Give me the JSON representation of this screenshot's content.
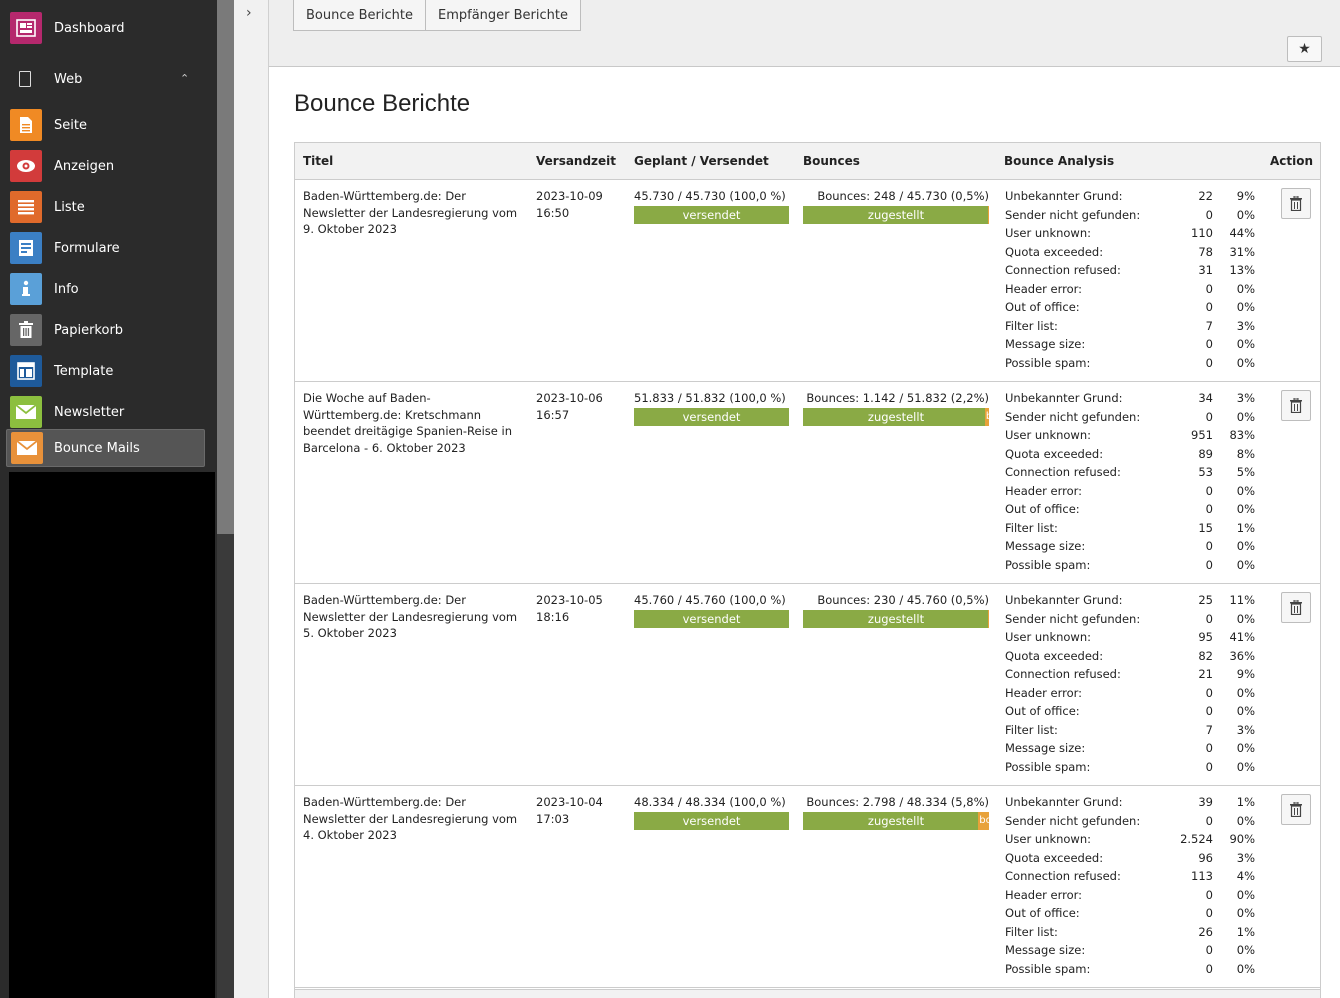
{
  "sidebar": {
    "dashboard": "Dashboard",
    "web_group": "Web",
    "items": [
      {
        "label": "Seite",
        "color": "#f08a24",
        "icon": "page-icon"
      },
      {
        "label": "Anzeigen",
        "color": "#d23b3b",
        "icon": "eye-icon"
      },
      {
        "label": "Liste",
        "color": "#e06a2b",
        "icon": "list-icon"
      },
      {
        "label": "Formulare",
        "color": "#3b7fc4",
        "icon": "form-icon"
      },
      {
        "label": "Info",
        "color": "#5aa0d8",
        "icon": "info-icon"
      },
      {
        "label": "Papierkorb",
        "color": "#666666",
        "icon": "trash-icon"
      },
      {
        "label": "Template",
        "color": "#1e5a9a",
        "icon": "template-icon"
      },
      {
        "label": "Newsletter",
        "color": "#8cbf3f",
        "icon": "mail-icon"
      },
      {
        "label": "Bounce Mails",
        "color": "#e8913a",
        "icon": "mail-icon",
        "active": true
      }
    ],
    "dashboard_color": "#b5286d"
  },
  "tabs": [
    "Bounce Berichte",
    "Empfänger Berichte"
  ],
  "page_title": "Bounce Berichte",
  "table": {
    "headers": {
      "title": "Titel",
      "time": "Versandzeit",
      "planned": "Geplant / Versendet",
      "bounces": "Bounces",
      "analysis": "Bounce Analysis",
      "action": "Action"
    },
    "sent_label": "versendet",
    "delivered_label": "zugestellt",
    "analysis_keys": [
      "Unbekannter Grund:",
      "Sender nicht gefunden:",
      "User unknown:",
      "Quota exceeded:",
      "Connection refused:",
      "Header error:",
      "Out of office:",
      "Filter list:",
      "Message size:",
      "Possible spam:"
    ],
    "rows": [
      {
        "title_visible": [
          "Baden-Württemberg.de: Der",
          "Newsletter der Landesregierung vom",
          "9. Oktober 2023"
        ],
        "date": "2023-10-09",
        "time": "16:50",
        "planned": "45.730 / 45.730 (100,0 %)",
        "bounces": "Bounces: 248 / 45.730 (0,5%)",
        "bounce_fraction": 0.005,
        "orange_label": "",
        "nums": [
          "22",
          "0",
          "110",
          "78",
          "31",
          "0",
          "0",
          "7",
          "0",
          "0"
        ],
        "pcts": [
          "9%",
          "0%",
          "44%",
          "31%",
          "13%",
          "0%",
          "0%",
          "3%",
          "0%",
          "0%"
        ]
      },
      {
        "title_visible": [
          "Die Woche auf Baden-",
          "Württemberg.de: Kretschmann",
          "beendet dreitägige Spanien-Reise in",
          "Barcelona - 6. Oktober 2023"
        ],
        "date": "2023-10-06",
        "time": "16:57",
        "planned": "51.833 / 51.832 (100,0 %)",
        "bounces": "Bounces: 1.142 / 51.832 (2,2%)",
        "bounce_fraction": 0.022,
        "orange_label": "b",
        "nums": [
          "34",
          "0",
          "951",
          "89",
          "53",
          "0",
          "0",
          "15",
          "0",
          "0"
        ],
        "pcts": [
          "3%",
          "0%",
          "83%",
          "8%",
          "5%",
          "0%",
          "0%",
          "1%",
          "0%",
          "0%"
        ]
      },
      {
        "title_visible": [
          "Baden-Württemberg.de: Der",
          "Newsletter der Landesregierung vom",
          "5. Oktober 2023"
        ],
        "date": "2023-10-05",
        "time": "18:16",
        "planned": "45.760 / 45.760 (100,0 %)",
        "bounces": "Bounces: 230 / 45.760 (0,5%)",
        "bounce_fraction": 0.005,
        "orange_label": "",
        "nums": [
          "25",
          "0",
          "95",
          "82",
          "21",
          "0",
          "0",
          "7",
          "0",
          "0"
        ],
        "pcts": [
          "11%",
          "0%",
          "41%",
          "36%",
          "9%",
          "0%",
          "0%",
          "3%",
          "0%",
          "0%"
        ]
      },
      {
        "title_visible": [
          "Baden-Württemberg.de: Der",
          "Newsletter der Landesregierung vom",
          "4. Oktober 2023"
        ],
        "date": "2023-10-04",
        "time": "17:03",
        "planned": "48.334 / 48.334 (100,0 %)",
        "bounces": "Bounces: 2.798 / 48.334 (5,8%)",
        "bounce_fraction": 0.058,
        "orange_label": "bo",
        "nums": [
          "39",
          "0",
          "2.524",
          "96",
          "113",
          "0",
          "0",
          "26",
          "0",
          "0"
        ],
        "pcts": [
          "1%",
          "0%",
          "90%",
          "3%",
          "4%",
          "0%",
          "0%",
          "1%",
          "0%",
          "0%"
        ]
      }
    ]
  }
}
